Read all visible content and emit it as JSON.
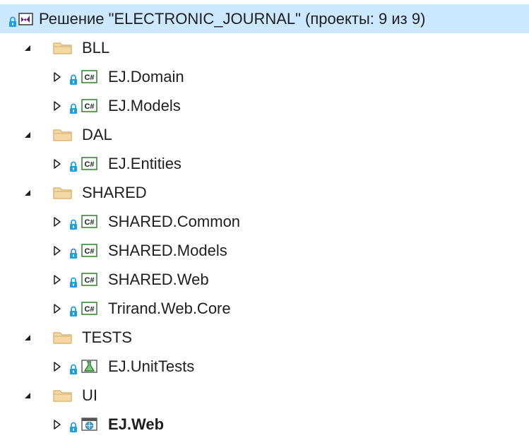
{
  "solution": {
    "label": "Решение \"ELECTRONIC_JOURNAL\" (проекты: 9 из 9)",
    "icon": "solution-icon"
  },
  "folders": [
    {
      "label": "BLL",
      "expanded": true,
      "projects": [
        {
          "label": "EJ.Domain",
          "type": "csharp",
          "bold": false
        },
        {
          "label": "EJ.Models",
          "type": "csharp",
          "bold": false
        }
      ]
    },
    {
      "label": "DAL",
      "expanded": true,
      "projects": [
        {
          "label": "EJ.Entities",
          "type": "csharp",
          "bold": false
        }
      ]
    },
    {
      "label": "SHARED",
      "expanded": true,
      "projects": [
        {
          "label": "SHARED.Common",
          "type": "csharp",
          "bold": false
        },
        {
          "label": "SHARED.Models",
          "type": "csharp",
          "bold": false
        },
        {
          "label": "SHARED.Web",
          "type": "csharp",
          "bold": false
        },
        {
          "label": "Trirand.Web.Core",
          "type": "csharp",
          "bold": false
        }
      ]
    },
    {
      "label": "TESTS",
      "expanded": true,
      "projects": [
        {
          "label": "EJ.UnitTests",
          "type": "test",
          "bold": false
        }
      ]
    },
    {
      "label": "UI",
      "expanded": true,
      "projects": [
        {
          "label": "EJ.Web",
          "type": "web",
          "bold": true
        }
      ]
    }
  ],
  "colors": {
    "selection": "#cce8ff",
    "text": "#1e1e1e",
    "folder": "#dcb67a",
    "lock": "#1ba1e2",
    "csharp": "#388a34",
    "expander": "#1e1e1e"
  }
}
